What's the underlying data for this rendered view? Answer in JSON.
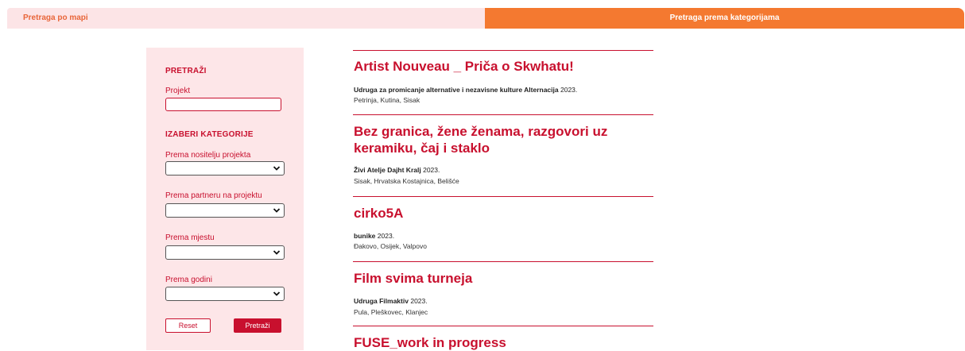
{
  "tabs": {
    "map_label": "Pretraga po mapi",
    "category_label": "Pretraga prema kategorijama"
  },
  "sidebar": {
    "search_heading": "PRETRAŽI",
    "project_label": "Projekt",
    "project_value": "",
    "categories_heading": "IZABERI KATEGORIJE",
    "filters": [
      {
        "label": "Prema nositelju projekta",
        "value": ""
      },
      {
        "label": "Prema partneru na projektu",
        "value": ""
      },
      {
        "label": "Prema mjestu",
        "value": ""
      },
      {
        "label": "Prema godini",
        "value": ""
      }
    ],
    "reset_label": "Reset",
    "search_label": "Pretraži"
  },
  "projects": [
    {
      "title": "Artist Nouveau _ Priča o Skwhatu!",
      "org": "Udruga za promicanje alternative i nezavisne kulture Alternacija",
      "year": "2023.",
      "places": "Petrinja, Kutina, Sisak"
    },
    {
      "title": "Bez granica, žene ženama, razgovori uz keramiku, čaj i staklo",
      "org": "Živi Atelje Dajht Kralj",
      "year": "2023.",
      "places": "Sisak, Hrvatska Kostajnica, Belišće"
    },
    {
      "title": "cirko5A",
      "org": "bunike",
      "year": "2023.",
      "places": "Đakovo, Osijek, Valpovo"
    },
    {
      "title": "Film svima turneja",
      "org": "Udruga Filmaktiv",
      "year": "2023.",
      "places": "Pula, Pleškovec, Klanjec"
    },
    {
      "title": "FUSE_work in progress",
      "org": "",
      "year": "",
      "places": ""
    }
  ],
  "colors": {
    "accent": "#c8102e",
    "tab_active": "#f47930",
    "tab_inactive": "#fce4e6",
    "sidebar_bg": "#fde6e8"
  }
}
